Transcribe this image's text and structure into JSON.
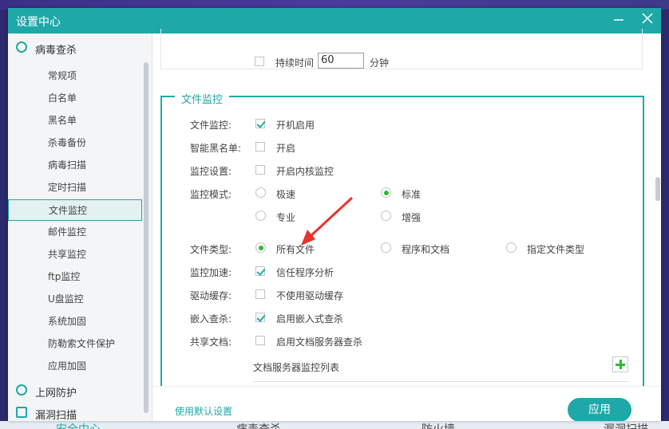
{
  "window": {
    "title": "设置中心",
    "minimize_icon": "minimize-icon",
    "close_icon": "close-icon"
  },
  "sidebar": {
    "section1": "病毒查杀",
    "items": [
      "常规项",
      "白名单",
      "黑名单",
      "杀毒备份",
      "病毒扫描",
      "定时扫描",
      "文件监控",
      "邮件监控",
      "共享监控",
      "ftp监控",
      "U盘监控",
      "系统加固",
      "防勒索文件保护",
      "应用加固"
    ],
    "active_index": 6,
    "section2": "上网防护",
    "section3": "漏洞扫描"
  },
  "top": {
    "checkbox_label": "持续时间",
    "value": "60",
    "unit": "分钟"
  },
  "group": {
    "legend": "文件监控",
    "rows": [
      {
        "label": "文件监控:",
        "option": "开机启用"
      },
      {
        "label": "智能黑名单:",
        "option": "开启"
      },
      {
        "label": "监控设置:",
        "option": "开启内核监控"
      },
      {
        "label": "监控模式:",
        "options": [
          "极速",
          "标准",
          "专业",
          "增强"
        ]
      },
      {
        "label": "文件类型:",
        "options": [
          "所有文件",
          "程序和文档",
          "指定文件类型"
        ]
      },
      {
        "label": "监控加速:",
        "option": "信任程序分析"
      },
      {
        "label": "驱动缓存:",
        "option": "不使用驱动缓存"
      },
      {
        "label": "嵌入查杀:",
        "option": "启用嵌入式查杀"
      },
      {
        "label": "共享文档:",
        "option": "启用文档服务器查杀"
      }
    ],
    "list_title": "文档服务器监控列表"
  },
  "footer": {
    "default_link": "使用默认设置",
    "apply": "应用"
  },
  "background_tabs": [
    "安全中心",
    "病毒查杀",
    "防火墙",
    "漏洞扫描"
  ],
  "colors": {
    "accent": "#1fa8a8",
    "radio_on": "#2fb82f",
    "arrow": "#e8332a"
  }
}
